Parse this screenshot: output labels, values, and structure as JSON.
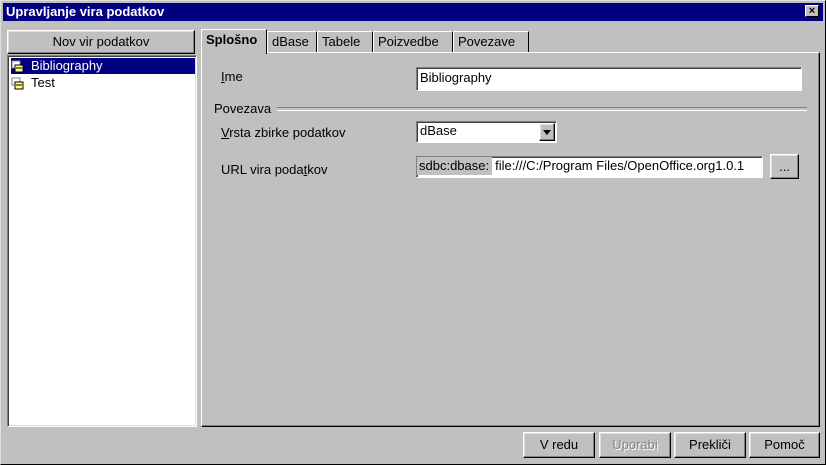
{
  "window": {
    "title": "Upravljanje vira podatkov",
    "close_label": "×"
  },
  "left": {
    "new_source_button": "Nov vir podatkov",
    "sources": [
      {
        "label": "Bibliography",
        "selected": true,
        "icon": "database-icon"
      },
      {
        "label": "Test",
        "selected": false,
        "icon": "database-icon"
      }
    ]
  },
  "tabs": [
    {
      "label": "Splošno",
      "active": true
    },
    {
      "label": "dBase",
      "active": false
    },
    {
      "label": "Tabele",
      "active": false
    },
    {
      "label": "Poizvedbe",
      "active": false
    },
    {
      "label": "Povezave",
      "active": false
    }
  ],
  "general": {
    "name_label": "Ime",
    "name_value": "Bibliography",
    "connection_group": "Povezava",
    "db_type_label": "Vrsta zbirke podatkov",
    "db_type_value": "dBase",
    "url_label": "URL vira podatkov",
    "url_prefix": "sdbc:dbase:",
    "url_value": "file:///C:/Program Files/OpenOffice.org1.0.1",
    "browse_label": "..."
  },
  "footer": {
    "ok": "V redu",
    "apply": "Uporabi",
    "cancel": "Prekliči",
    "help": "Pomoč"
  }
}
